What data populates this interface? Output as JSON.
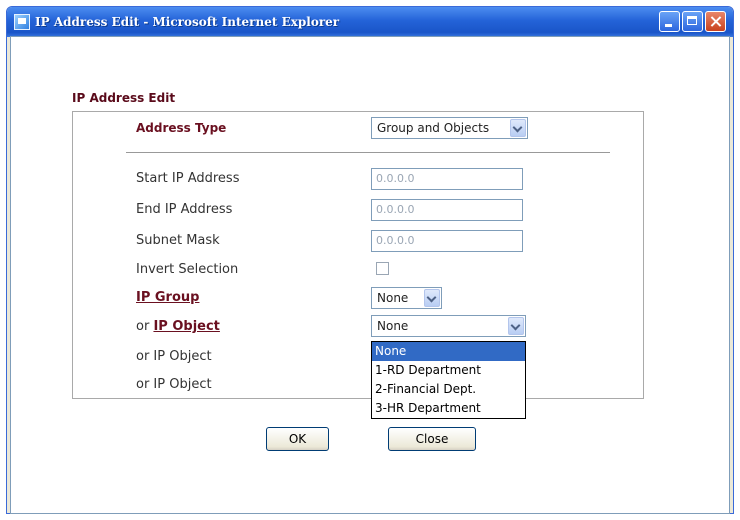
{
  "window": {
    "title": "IP Address Edit - Microsoft Internet Explorer"
  },
  "form": {
    "heading": "IP Address Edit",
    "address_type_label": "Address Type",
    "address_type_value": "Group and Objects",
    "start_ip_label": "Start IP Address",
    "start_ip_value": "0.0.0.0",
    "end_ip_label": "End IP Address",
    "end_ip_value": "0.0.0.0",
    "subnet_mask_label": "Subnet Mask",
    "subnet_mask_value": "0.0.0.0",
    "invert_label": "Invert Selection",
    "invert_checked": false,
    "ip_group_label": "IP Group",
    "ip_group_value": "None",
    "ip_object_prefix": "or",
    "ip_object_link": "IP Object",
    "ip_object_1_value": "None",
    "ip_object_2_label": "or IP Object",
    "ip_object_3_label": "or IP Object"
  },
  "dropdown": {
    "options": [
      "None",
      "1-RD Department",
      "2-Financial Dept.",
      "3-HR Department"
    ],
    "selected_index": 0
  },
  "buttons": {
    "ok": "OK",
    "close": "Close"
  }
}
